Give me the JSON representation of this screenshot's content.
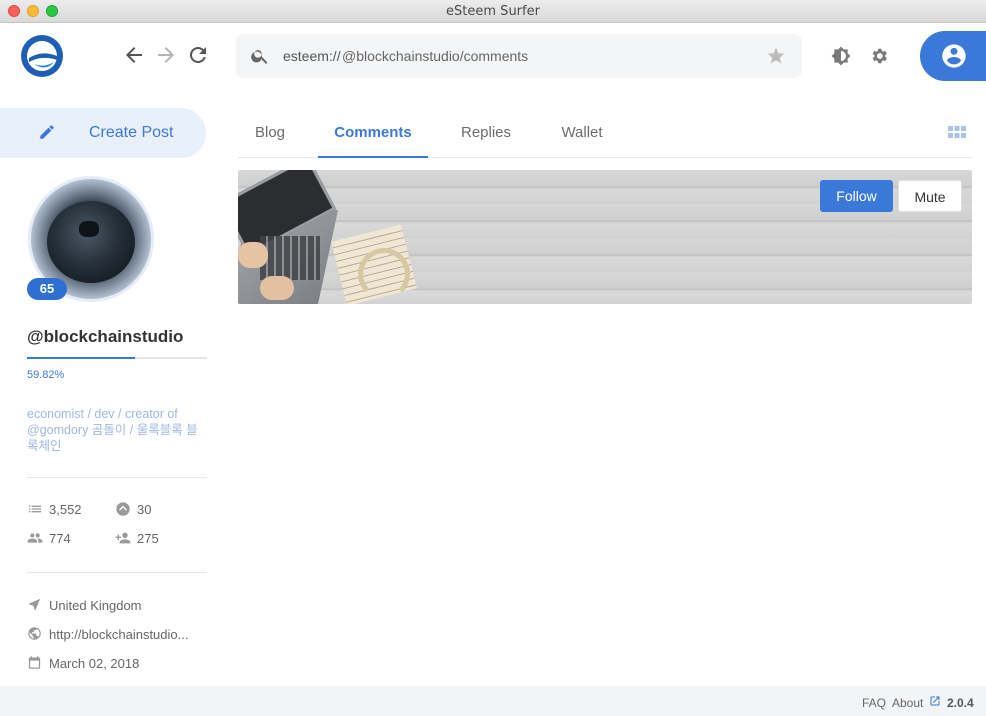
{
  "window": {
    "title": "eSteem Surfer"
  },
  "header": {
    "logo_icon": "esteem-logo-icon",
    "address": {
      "protocol": "esteem://",
      "path": "@blockchainstudio/comments"
    }
  },
  "sidebar": {
    "create_post_label": "Create Post",
    "reputation": "65",
    "username": "@blockchainstudio",
    "voting_power_text": "59.82%",
    "voting_power_value": 59.82,
    "bio": "economist / dev / creator of @gomdory 곰돌이 / 울록블록 블록체인",
    "stats": {
      "posts": "3,552",
      "votes": "30",
      "followers": "774",
      "following": "275"
    },
    "location": "United Kingdom",
    "website": "http://blockchainstudio...",
    "joined": "March 02, 2018"
  },
  "tabs": [
    {
      "label": "Blog",
      "active": false
    },
    {
      "label": "Comments",
      "active": true
    },
    {
      "label": "Replies",
      "active": false
    },
    {
      "label": "Wallet",
      "active": false
    }
  ],
  "profile_actions": {
    "follow_label": "Follow",
    "mute_label": "Mute"
  },
  "footer": {
    "faq": "FAQ",
    "about": "About",
    "version": "2.0.4"
  },
  "colors": {
    "accent": "#3a79d8",
    "reputation_badge": "#2f6fd2"
  }
}
